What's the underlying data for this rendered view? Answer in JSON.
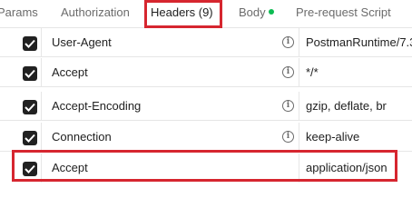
{
  "tabs": {
    "params": "Params",
    "authorization": "Authorization",
    "headers": "Headers (9)",
    "body": "Body",
    "prerequest": "Pre-request Script"
  },
  "colors": {
    "accent": "#ff6c37",
    "highlight": "#d6262f",
    "body_dot": "#0cbb52",
    "checkbox": "#212121"
  },
  "rows": [
    {
      "key": "User-Agent",
      "value": "PostmanRuntime/7.3",
      "checked": true,
      "info_icon": true
    },
    {
      "key": "Accept",
      "value": "*/*",
      "checked": true,
      "info_icon": true
    },
    {
      "key": "Accept-Encoding",
      "value": "gzip, deflate, br",
      "checked": true,
      "info_icon": true
    },
    {
      "key": "Connection",
      "value": "keep-alive",
      "checked": true,
      "info_icon": true
    },
    {
      "key": "Accept",
      "value": "application/json",
      "checked": true,
      "info_icon": false
    }
  ]
}
